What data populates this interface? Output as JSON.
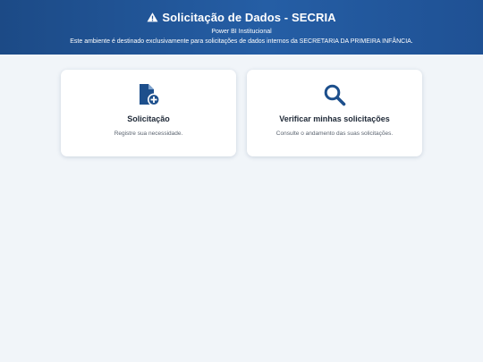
{
  "header": {
    "title": "Solicitação de Dados - SECRIA",
    "subtitle": "Power BI Institucional",
    "description": "Este ambiente é destinado exclusivamente para solicitações de dados internos da SECRETARIA DA PRIMEIRA INFÂNCIA.",
    "icon": "warning-icon"
  },
  "cards": [
    {
      "icon": "file-plus-icon",
      "label": "Solicitação",
      "text": "Registre sua necessidade."
    },
    {
      "icon": "search-icon",
      "label": "Verificar minhas solicitações",
      "text": "Consulte o andamento das suas solicitações."
    }
  ],
  "colors": {
    "header_start": "#1c4a86",
    "header_end": "#255ea5",
    "icon_blue": "#1d4f8c",
    "background": "#f1f5f9"
  }
}
